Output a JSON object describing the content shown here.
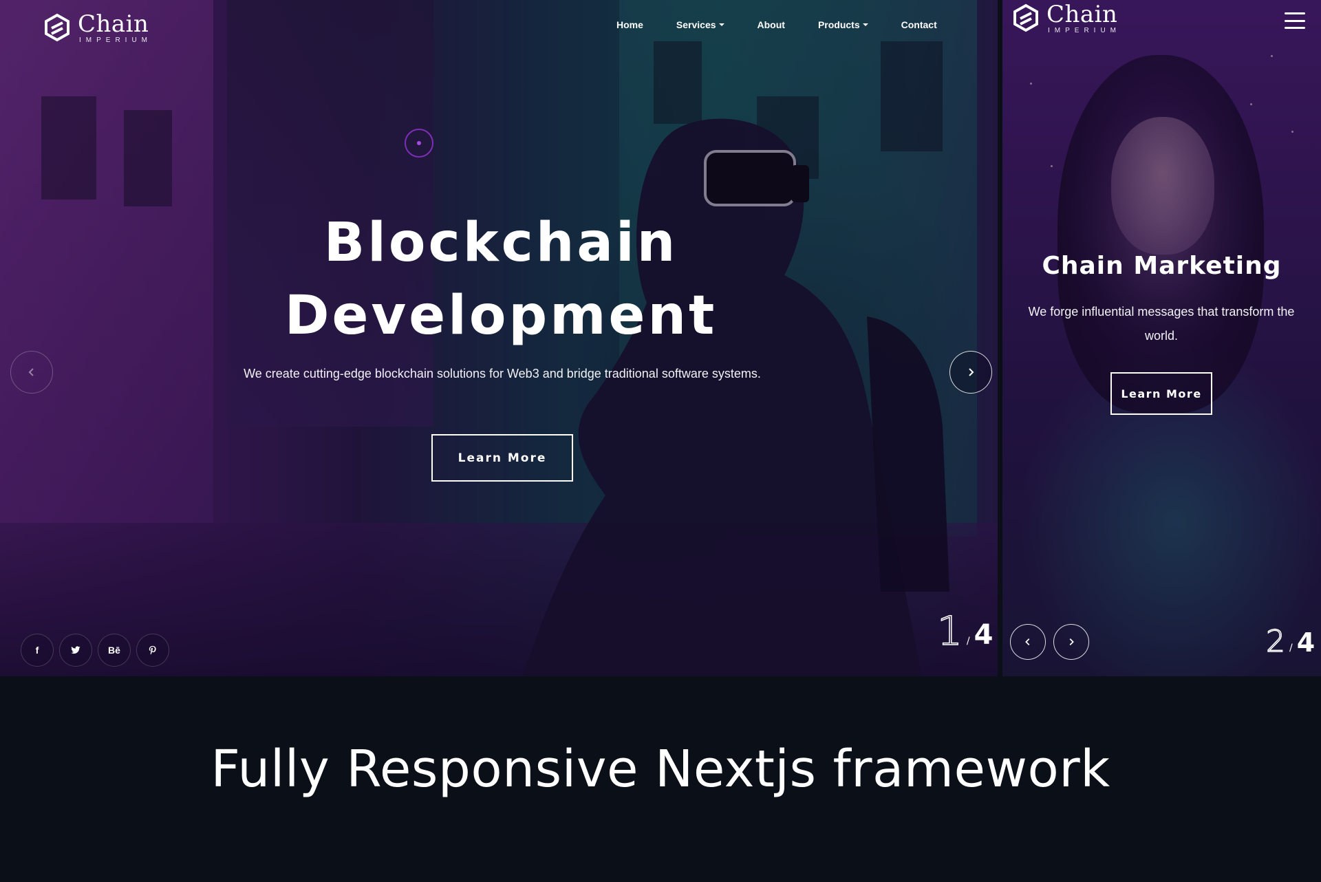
{
  "desktop": {
    "logo": {
      "name": "Chain",
      "sub": "IMPERIUM"
    },
    "nav": [
      {
        "label": "Home",
        "dropdown": false
      },
      {
        "label": "Services",
        "dropdown": true
      },
      {
        "label": "About",
        "dropdown": false
      },
      {
        "label": "Products",
        "dropdown": true
      },
      {
        "label": "Contact",
        "dropdown": false
      }
    ],
    "hero": {
      "title_line1": "Blockchain",
      "title_line2": "Development",
      "text": "We create cutting-edge blockchain solutions for Web3 and bridge traditional software systems.",
      "button": "Learn More"
    },
    "counter": {
      "current": "1",
      "separator": "/",
      "total": "4"
    },
    "socials": [
      {
        "icon": "facebook-icon",
        "glyph": "f"
      },
      {
        "icon": "twitter-icon",
        "glyph": ""
      },
      {
        "icon": "behance-icon",
        "glyph": "Bē"
      },
      {
        "icon": "pinterest-icon",
        "glyph": ""
      }
    ]
  },
  "mobile": {
    "logo": {
      "name": "Chain",
      "sub": "IMPERIUM"
    },
    "title": "Chain Marketing",
    "text": "We forge influential messages that transform the world.",
    "button": "Learn More",
    "counter": {
      "current": "2",
      "separator": "/",
      "total": "4"
    }
  },
  "band": {
    "title": "Fully Responsive Nextjs framework"
  },
  "colors": {
    "accent": "#7d2fb6",
    "background": "#0b0f17"
  }
}
